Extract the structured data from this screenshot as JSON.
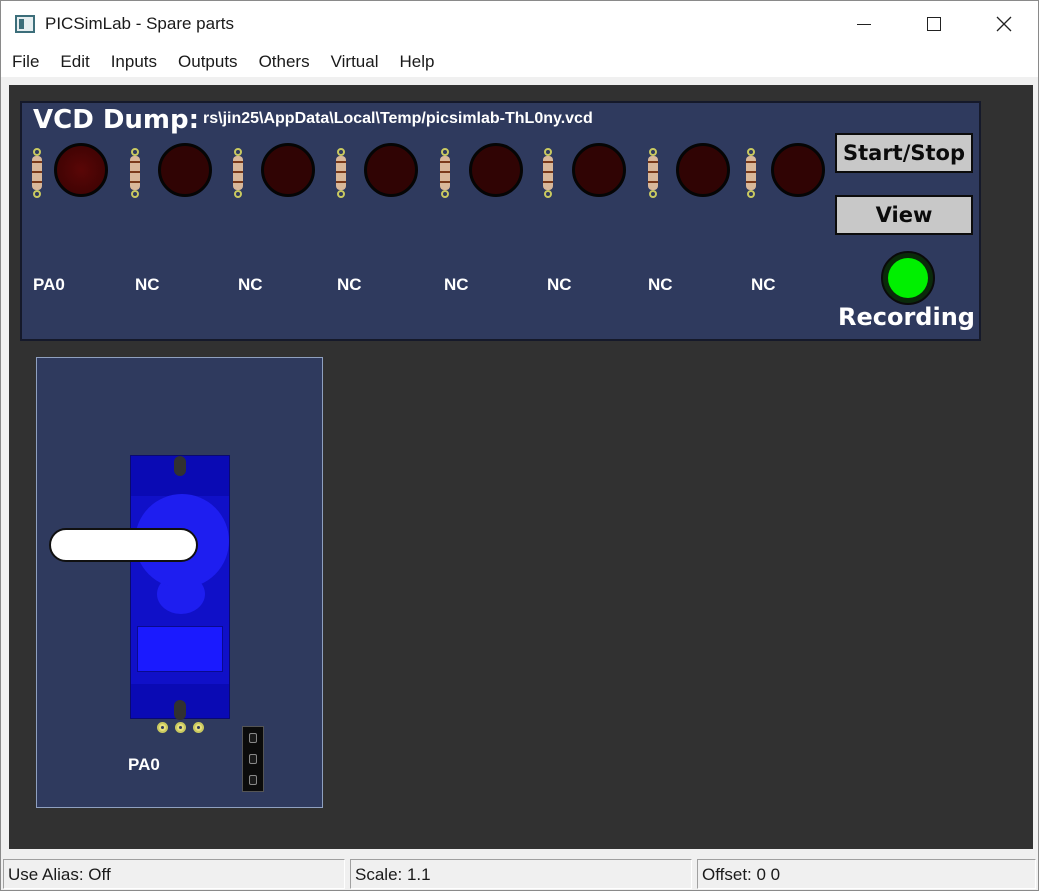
{
  "window": {
    "title": "PICSimLab - Spare parts"
  },
  "menu": {
    "items": [
      "File",
      "Edit",
      "Inputs",
      "Outputs",
      "Others",
      "Virtual",
      "Help"
    ]
  },
  "vcd": {
    "title": "VCD Dump:",
    "path": "rs\\jin25\\AppData\\Local\\Temp/picsimlab-ThL0ny.vcd",
    "channels": [
      "PA0",
      "NC",
      "NC",
      "NC",
      "NC",
      "NC",
      "NC",
      "NC"
    ],
    "start_stop_label": "Start/Stop",
    "view_label": "View",
    "recording_label": "Recording",
    "recording_color": "#00f000"
  },
  "servo": {
    "pin_label": "PA0"
  },
  "status": {
    "alias": "Use Alias: Off",
    "scale": "Scale: 1.1",
    "offset": "Offset:  0  0"
  }
}
